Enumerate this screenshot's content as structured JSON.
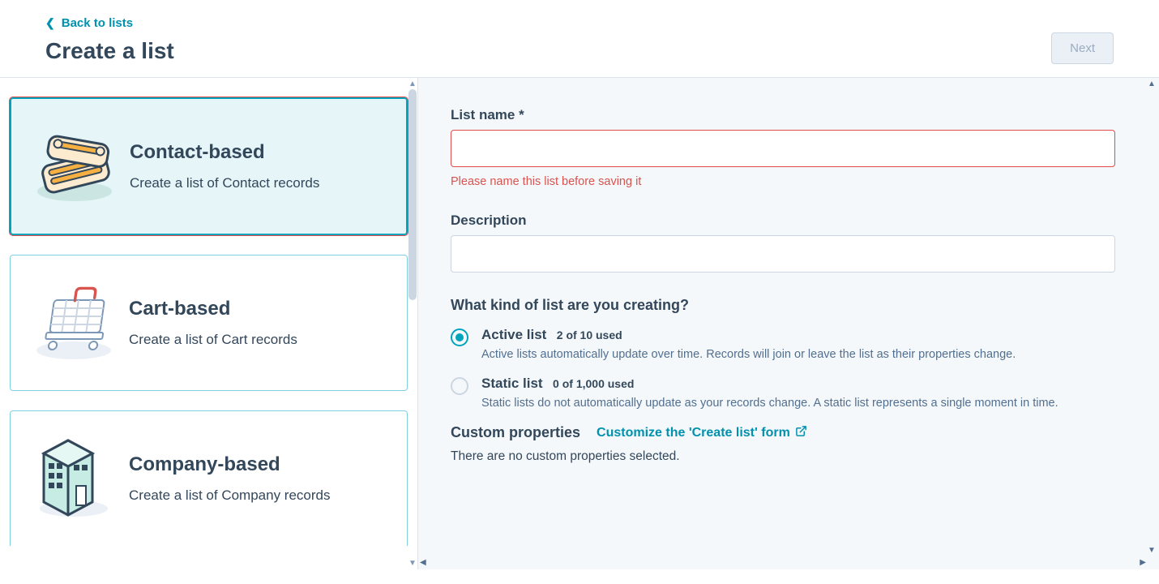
{
  "header": {
    "back_label": "Back to lists",
    "title": "Create a list",
    "next_label": "Next"
  },
  "cards": [
    {
      "title": "Contact-based",
      "desc": "Create a list of Contact records",
      "selected": true
    },
    {
      "title": "Cart-based",
      "desc": "Create a list of Cart records",
      "selected": false
    },
    {
      "title": "Company-based",
      "desc": "Create a list of Company records",
      "selected": false
    }
  ],
  "form": {
    "list_name_label": "List name *",
    "list_name_value": "",
    "list_name_error": "Please name this list before saving it",
    "description_label": "Description",
    "description_value": "",
    "kind_heading": "What kind of list are you creating?",
    "radios": [
      {
        "title": "Active list",
        "usage": "2 of 10 used",
        "desc": "Active lists automatically update over time. Records will join or leave the list as their properties change.",
        "checked": true
      },
      {
        "title": "Static list",
        "usage": "0 of 1,000 used",
        "desc": "Static lists do not automatically update as your records change. A static list represents a single moment in time.",
        "checked": false
      }
    ],
    "custom_props_title": "Custom properties",
    "custom_props_link": "Customize the 'Create list' form",
    "custom_props_empty": "There are no custom properties selected."
  }
}
